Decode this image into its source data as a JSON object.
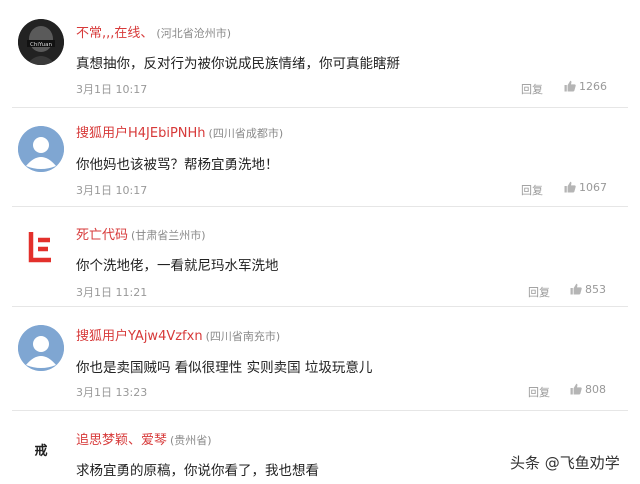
{
  "comments": [
    {
      "username": "不常,,,在线、",
      "location": "(河北省沧州市)",
      "text": "真想抽你，反对行为被你说成民族情绪，你可真能瞎掰",
      "time": "3月1日 10:17",
      "reply": "回复",
      "likes": "1266",
      "avatar": "dark-photo",
      "avatar_text": "ChiYuan"
    },
    {
      "username": "搜狐用户H4JEbiPNHh",
      "location": "(四川省成都市)",
      "text": "你他妈也该被骂？帮杨宜勇洗地！",
      "time": "3月1日 10:17",
      "reply": "回复",
      "likes": "1067",
      "avatar": "sohu-default"
    },
    {
      "username": "死亡代码",
      "location": "(甘肃省兰州市)",
      "text": "你个洗地佬，一看就尼玛水军洗地",
      "time": "3月1日 11:21",
      "reply": "回复",
      "likes": "853",
      "avatar": "le-logo"
    },
    {
      "username": "搜狐用户YAjw4Vzfxn",
      "location": "(四川省南充市)",
      "text": "你也是卖国贼吗 看似很理性 实则卖国 垃圾玩意儿",
      "time": "3月1日 13:23",
      "reply": "回复",
      "likes": "808",
      "avatar": "sohu-default"
    },
    {
      "username": "追思梦颖、爱琴",
      "location": "(贵州省)",
      "text": "求杨宜勇的原稿，你说你看了，我也想看",
      "avatar": "char",
      "avatar_text": "戒"
    }
  ],
  "watermark": "头条 @飞鱼劝学",
  "colors": {
    "username": "#d73a3a",
    "text": "#222222",
    "meta": "#999999",
    "divider": "#e6e6e6",
    "sohu_avatar": "#7fa6d2"
  }
}
